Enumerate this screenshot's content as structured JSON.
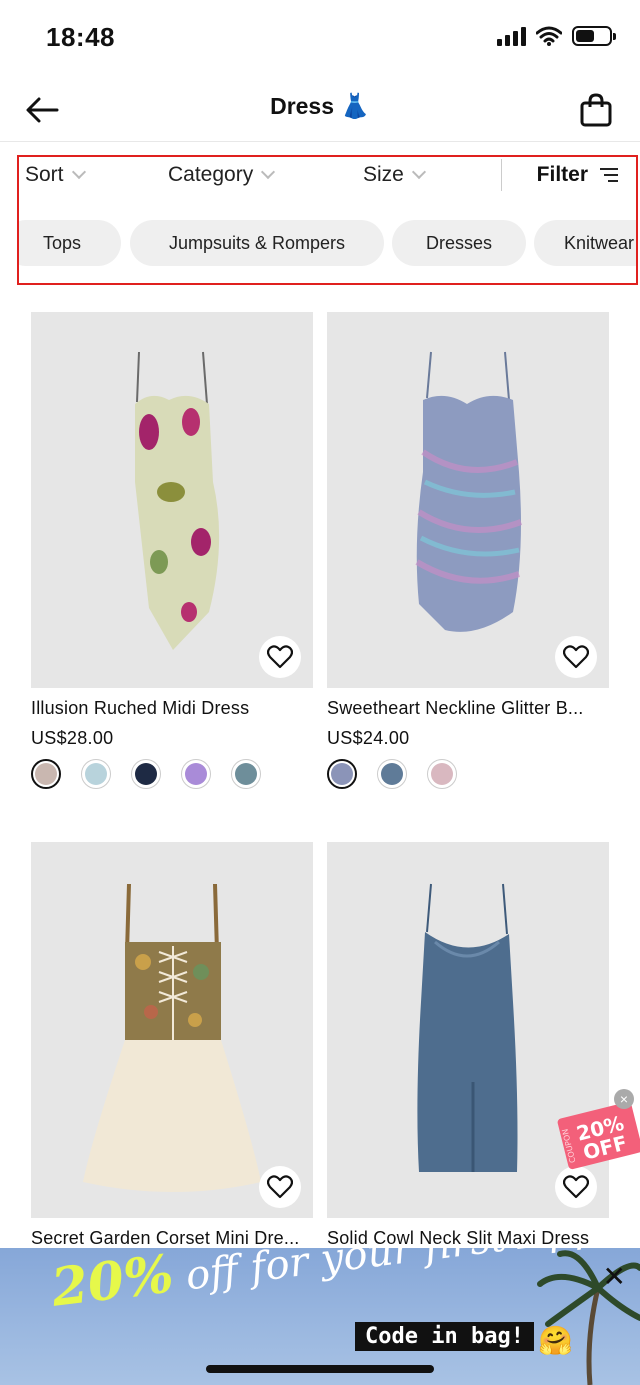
{
  "status_bar": {
    "time": "18:48"
  },
  "header": {
    "title": "Dress",
    "title_emoji": "👗"
  },
  "filters": {
    "sort_label": "Sort",
    "category_label": "Category",
    "size_label": "Size",
    "filter_label": "Filter",
    "chips": [
      "Tops",
      "Jumpsuits & Rompers",
      "Dresses",
      "Knitwear"
    ]
  },
  "products": [
    {
      "name": "Illusion Ruched Midi Dress",
      "price": "US$28.00",
      "swatches": [
        "#c9b7b0",
        "#b8d3dc",
        "#1e2a44",
        "#a98bd8",
        "#6e8e9a"
      ]
    },
    {
      "name": "Sweetheart Neckline Glitter B...",
      "price": "US$24.00",
      "swatches": [
        "#8b94b8",
        "#5f7b98",
        "#d9b8c0"
      ]
    },
    {
      "name": "Secret Garden Corset Mini Dre...",
      "price": "",
      "swatches": []
    },
    {
      "name": "Solid Cowl Neck Slit Maxi Dress",
      "price": "",
      "swatches": []
    }
  ],
  "coupon": {
    "line1": "20%",
    "line2": "OFF",
    "side_text": "COUPON"
  },
  "banner": {
    "percent": "20%",
    "text": "off for your first App order!",
    "code_text": "Code in bag!",
    "emoji": "🤗"
  },
  "colors": {
    "highlight_border": "#e0201e",
    "chip_bg": "#efefef",
    "price_text": "#111111"
  }
}
